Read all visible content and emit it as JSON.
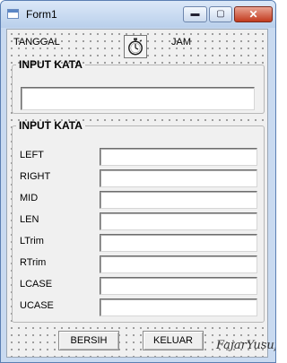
{
  "window": {
    "title": "Form1",
    "icon": "form-icon",
    "controls": [
      "minimize-icon",
      "maximize-icon",
      "close-icon"
    ]
  },
  "header": {
    "tanggal_label": "TANGGAL",
    "jam_label": "JAM",
    "timer_icon": "stopwatch-icon"
  },
  "input_section": {
    "title": "INPUT KATA",
    "value": ""
  },
  "functions_section": {
    "title": "INPUT KATA",
    "rows": [
      {
        "label": "LEFT",
        "value": ""
      },
      {
        "label": "RIGHT",
        "value": ""
      },
      {
        "label": "MID",
        "value": ""
      },
      {
        "label": "LEN",
        "value": ""
      },
      {
        "label": "LTrim",
        "value": ""
      },
      {
        "label": "RTrim",
        "value": ""
      },
      {
        "label": "LCASE",
        "value": ""
      },
      {
        "label": "UCASE",
        "value": ""
      }
    ]
  },
  "buttons": {
    "clear_label": "BERSIH",
    "exit_label": "KELUAR"
  },
  "watermark": "FajarYusuf",
  "colors": {
    "title_bar": "#c9daf0",
    "close_button": "#c23a1e",
    "form_background": "#f0f0f0"
  }
}
